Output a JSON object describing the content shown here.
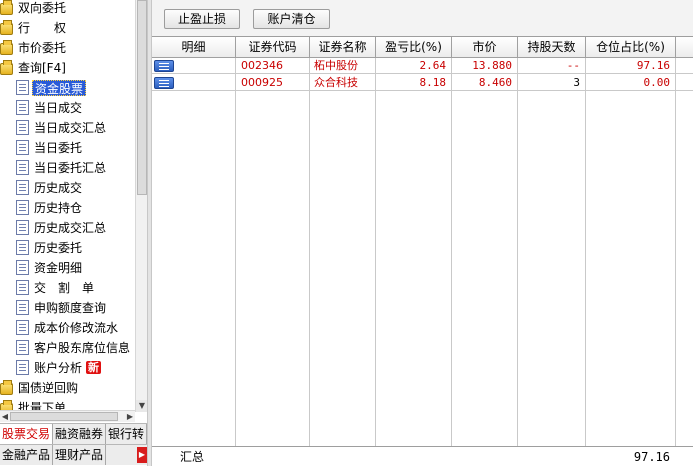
{
  "tree": {
    "items": [
      {
        "label": "双向委托",
        "icon": "wand-icon"
      },
      {
        "label": "行　　权",
        "icon": "wand-icon"
      },
      {
        "label": "市价委托",
        "icon": "wand-icon"
      },
      {
        "label": "查询[F4]",
        "icon": "folder-open-icon"
      },
      {
        "label": "资金股票",
        "icon": "document-icon",
        "selected": true
      },
      {
        "label": "当日成交",
        "icon": "document-icon"
      },
      {
        "label": "当日成交汇总",
        "icon": "document-icon"
      },
      {
        "label": "当日委托",
        "icon": "document-icon"
      },
      {
        "label": "当日委托汇总",
        "icon": "document-icon"
      },
      {
        "label": "历史成交",
        "icon": "document-icon"
      },
      {
        "label": "历史持仓",
        "icon": "document-icon"
      },
      {
        "label": "历史成交汇总",
        "icon": "document-icon"
      },
      {
        "label": "历史委托",
        "icon": "document-icon"
      },
      {
        "label": "资金明细",
        "icon": "document-icon"
      },
      {
        "label": "交　割　单",
        "icon": "document-icon"
      },
      {
        "label": "申购额度查询",
        "icon": "document-icon"
      },
      {
        "label": "成本价修改流水",
        "icon": "document-icon"
      },
      {
        "label": "客户股东席位信息",
        "icon": "document-icon"
      },
      {
        "label": "账户分析",
        "icon": "document-icon",
        "badge": "新"
      },
      {
        "label": "国债逆回购",
        "icon": "wand-icon"
      },
      {
        "label": "批量下单",
        "icon": "wand-icon"
      }
    ]
  },
  "tabs_row1": [
    "股票交易",
    "融资融券",
    "银行转"
  ],
  "tabs_row2": [
    "金融产品",
    "理财产品"
  ],
  "toolbar": {
    "stop_label": "止盈止损",
    "clear_label": "账户清仓"
  },
  "table": {
    "columns": [
      "明细",
      "证券代码",
      "证券名称",
      "盈亏比(%)",
      "市价",
      "持股天数",
      "仓位占比(%)"
    ],
    "rows": [
      {
        "code": "002346",
        "name": "柘中股份",
        "pnl": "2.64",
        "price": "13.880",
        "days": "--",
        "weight": "97.16"
      },
      {
        "code": "000925",
        "name": "众合科技",
        "pnl": "8.18",
        "price": "8.460",
        "days": "3",
        "weight": "0.00"
      }
    ],
    "footer": {
      "label": "汇总",
      "weight_total": "97.16"
    }
  },
  "colors": {
    "selection": "#2a5bd7",
    "value_red": "#c80000",
    "active_tab_text": "#d00000",
    "badge": "#e01010"
  }
}
